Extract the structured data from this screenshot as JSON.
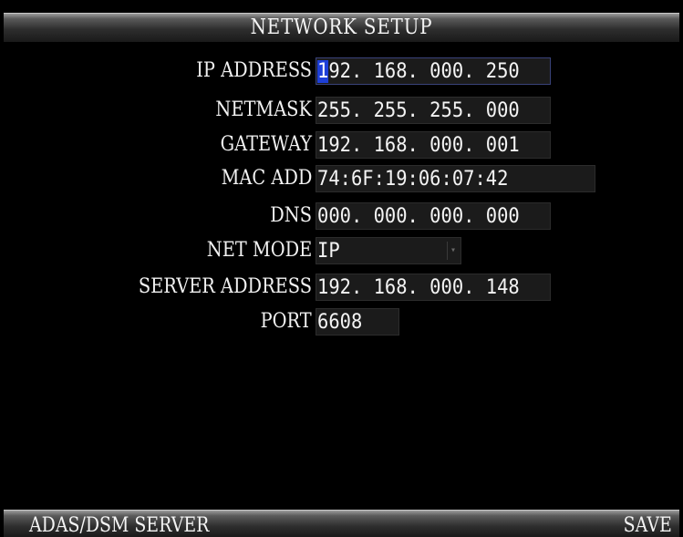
{
  "header": {
    "title": "NETWORK SETUP"
  },
  "form": {
    "ip_address": {
      "label": "IP ADDRESS",
      "cursor_char": "1",
      "rest": "92. 168. 000. 250"
    },
    "netmask": {
      "label": "NETMASK",
      "value": "255. 255. 255. 000"
    },
    "gateway": {
      "label": "GATEWAY",
      "value": "192. 168. 000. 001"
    },
    "mac_add": {
      "label": "MAC ADD",
      "value": "74:6F:19:06:07:42"
    },
    "dns": {
      "label": "DNS",
      "value": "000. 000. 000. 000"
    },
    "net_mode": {
      "label": "NET MODE",
      "value": "IP",
      "icon": "dropdown-arrow-icon"
    },
    "server_address": {
      "label": "SERVER ADDRESS",
      "value": "192. 168. 000. 148"
    },
    "port": {
      "label": "PORT",
      "value": "6608"
    }
  },
  "footer": {
    "left_button": "ADAS/DSM SERVER",
    "right_button": "SAVE"
  },
  "colors": {
    "background": "#000000",
    "field_background": "#1b1b1b",
    "cursor_highlight": "#1d3fd8",
    "text": "#f2f2f2"
  }
}
